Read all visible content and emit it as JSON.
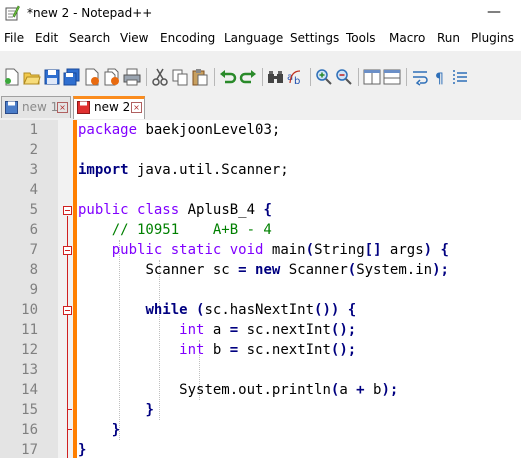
{
  "window": {
    "title": "*new 2 - Notepad++",
    "minimize_glyph": "—"
  },
  "menu": [
    "File",
    "Edit",
    "Search",
    "View",
    "Encoding",
    "Language",
    "Settings",
    "Tools",
    "Macro",
    "Run",
    "Plugins"
  ],
  "toolbar_icons": [
    "new-file-icon",
    "open-file-icon",
    "save-icon",
    "save-all-icon",
    "close-icon",
    "close-all-icon",
    "print-icon",
    "cut-icon",
    "copy-icon",
    "paste-icon",
    "undo-icon",
    "redo-icon",
    "find-icon",
    "replace-icon",
    "zoom-in-icon",
    "zoom-out-icon",
    "sync-vertical-icon",
    "sync-horizontal-icon",
    "word-wrap-icon",
    "show-all-chars-icon",
    "indent-guide-icon"
  ],
  "tabs": [
    {
      "label": "new 1",
      "active": false,
      "close_glyph": "×"
    },
    {
      "label": "new 2",
      "active": true,
      "close_glyph": "×"
    }
  ],
  "editor": {
    "line_numbers": [
      "1",
      "2",
      "3",
      "4",
      "5",
      "6",
      "7",
      "8",
      "9",
      "10",
      "11",
      "12",
      "13",
      "14",
      "15",
      "16",
      "17"
    ],
    "code": {
      "l1_kw": "package",
      "l1_rest": " baekjoonLevel03;",
      "l3_kw": "import",
      "l3_rest": " java.util.Scanner;",
      "l5_kw1": "public",
      "l5_kw2": "class",
      "l5_rest": " AplusB_4 ",
      "brace_open": "{",
      "brace_close": "}",
      "l6_comment": "// 10951    A+B - 4",
      "l7_kw1": "public",
      "l7_kw2": "static",
      "l7_kw3": "void",
      "l7_name": " main",
      "paren_open": "(",
      "paren_close": ")",
      "brackets": "[]",
      "l7_type": "String",
      "l7_args": " args",
      "l8_a": "Scanner sc ",
      "eq": "=",
      "l8_new": "new",
      "l8_b": " Scanner",
      "l8_sysin": "System.in",
      "semi": ";",
      "l10_kw": "while",
      "l10_a": "sc.hasNextInt",
      "l11_kw": "int",
      "l11_a": " a ",
      "l11_call": " sc.nextInt",
      "l12_kw": "int",
      "l12_a": " b ",
      "l12_call": " sc.nextInt",
      "l14_a": "System.out.println",
      "l14_arg1": "a ",
      "plus": "+",
      "l14_arg2": " b"
    }
  }
}
